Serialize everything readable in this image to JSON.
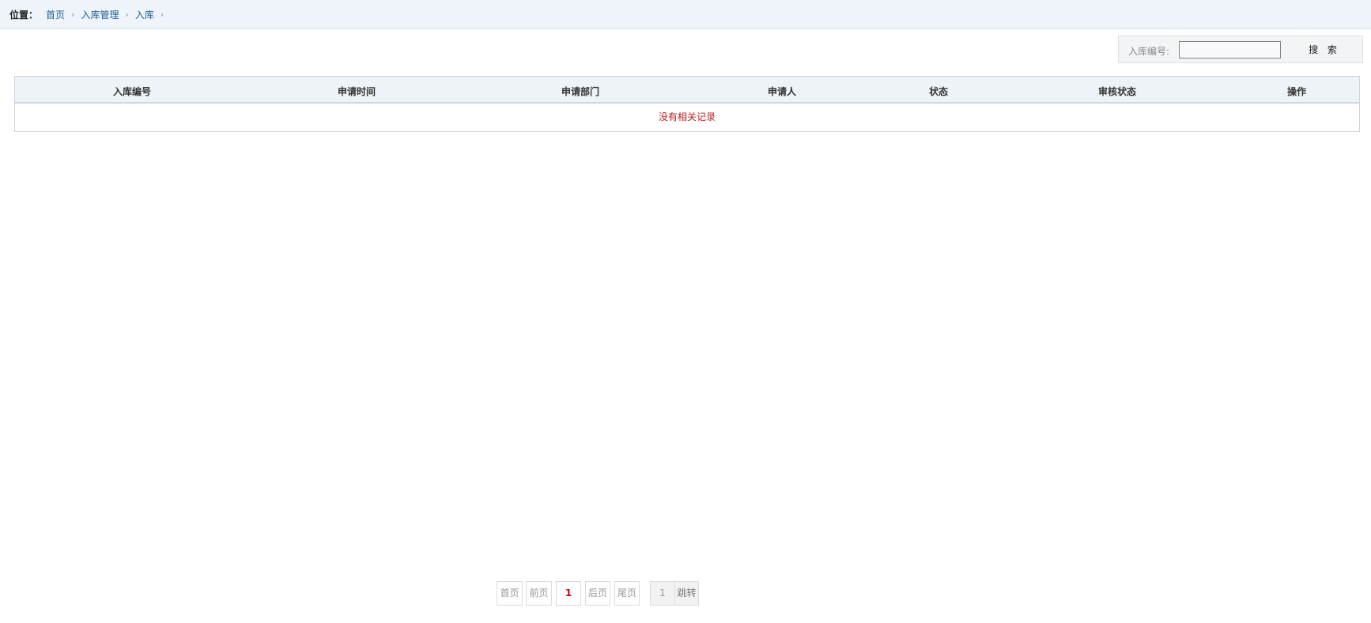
{
  "breadcrumb": {
    "label": "位置：",
    "items": [
      "首页",
      "入库管理",
      "入库"
    ],
    "separator": "›"
  },
  "search": {
    "label": "入库编号:",
    "value": "",
    "button": "搜 索"
  },
  "table": {
    "columns": [
      "入库编号",
      "申请时间",
      "申请部门",
      "申请人",
      "状态",
      "审核状态",
      "操作"
    ],
    "rows": [],
    "empty_text": "没有相关记录"
  },
  "pagination": {
    "first": "首页",
    "prev": "前页",
    "current": "1",
    "next": "后页",
    "last": "尾页",
    "jump_value": "1",
    "jump_button": "跳转"
  },
  "colors": {
    "topbar_bg": "#eef4fa",
    "link": "#1e5f94",
    "empty_text": "#b22222",
    "current_page": "#d40000"
  }
}
